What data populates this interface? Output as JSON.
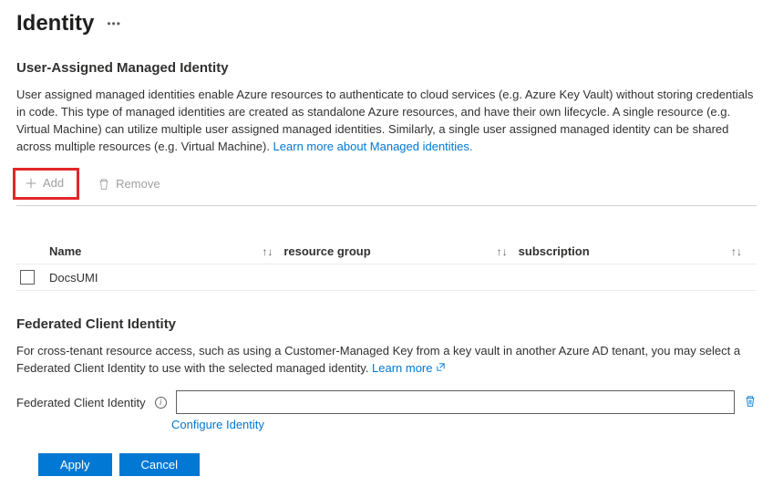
{
  "header": {
    "title": "Identity"
  },
  "umi": {
    "sectionTitle": "User-Assigned Managed Identity",
    "description": "User assigned managed identities enable Azure resources to authenticate to cloud services (e.g. Azure Key Vault) without storing credentials in code. This type of managed identities are created as standalone Azure resources, and have their own lifecycle. A single resource (e.g. Virtual Machine) can utilize multiple user assigned managed identities. Similarly, a single user assigned managed identity can be shared across multiple resources (e.g. Virtual Machine). ",
    "learnMoreLabel": "Learn more about Managed identities.",
    "toolbar": {
      "addLabel": "Add",
      "removeLabel": "Remove"
    },
    "table": {
      "columns": {
        "name": "Name",
        "resourceGroup": "resource group",
        "subscription": "subscription"
      },
      "rows": [
        {
          "name": "DocsUMI",
          "resourceGroup": "",
          "subscription": ""
        }
      ]
    }
  },
  "federated": {
    "sectionTitle": "Federated Client Identity",
    "description": "For cross-tenant resource access, such as using a Customer-Managed Key from a key vault in another Azure AD tenant, you may select a Federated Client Identity to use with the selected managed identity. ",
    "learnMoreLabel": "Learn more",
    "fieldLabel": "Federated Client Identity",
    "inputValue": "",
    "configureLabel": "Configure Identity"
  },
  "footer": {
    "applyLabel": "Apply",
    "cancelLabel": "Cancel"
  }
}
